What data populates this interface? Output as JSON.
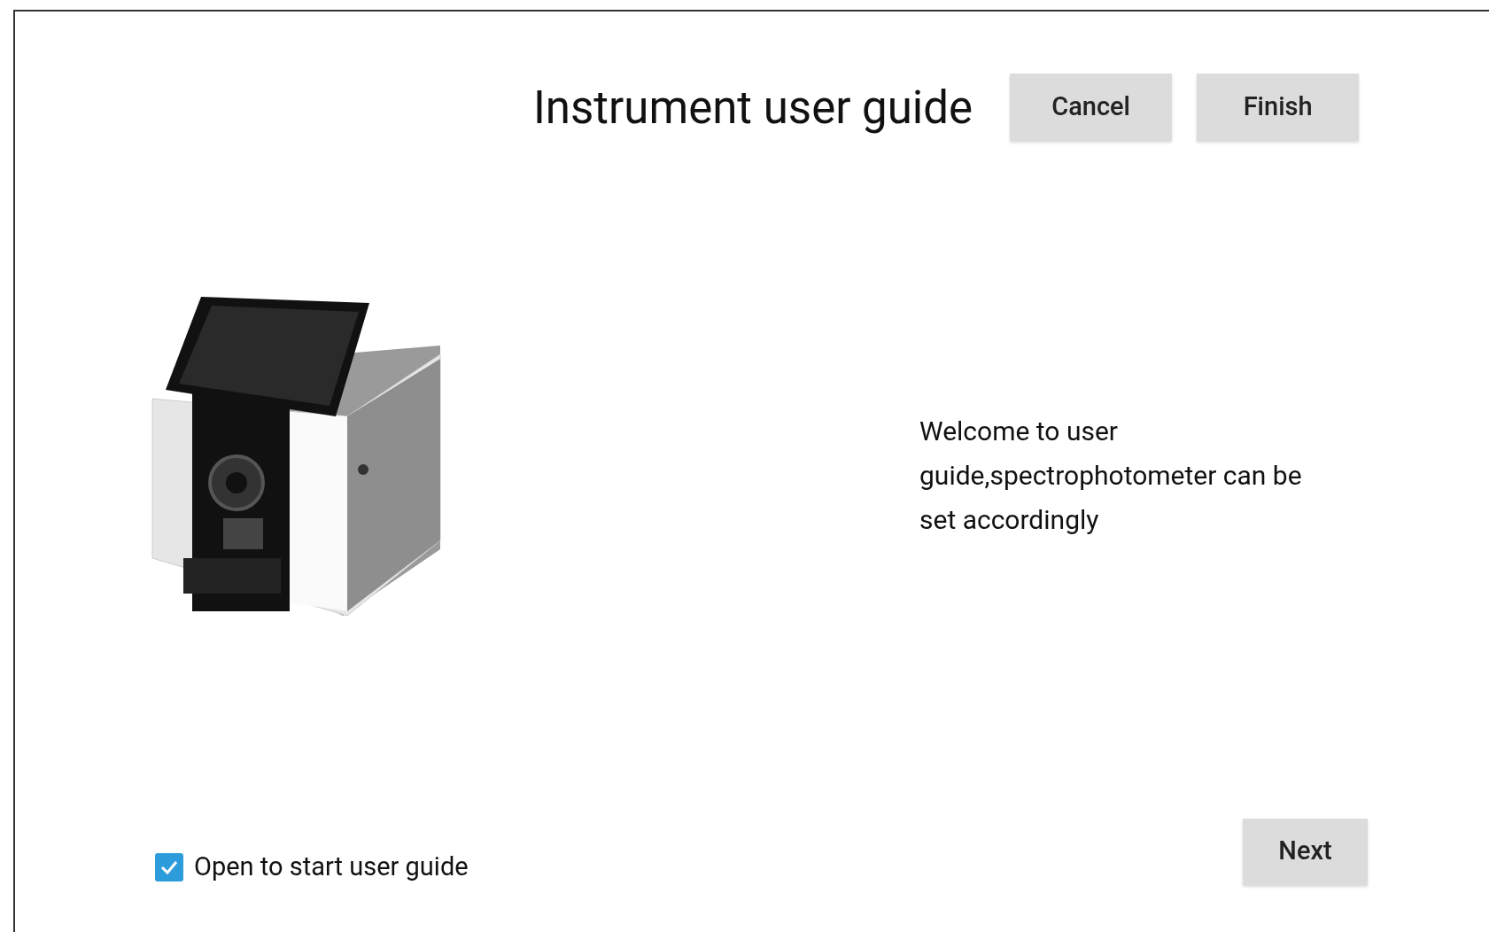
{
  "title": "Instrument user guide",
  "header_buttons": [
    "Cancel",
    "Finish"
  ],
  "message": "Welcome to user guide,spectrophotometer can be set accordingly",
  "startup_option": {
    "label": "Open to start user guide",
    "checked": true
  },
  "next_button": "Next"
}
